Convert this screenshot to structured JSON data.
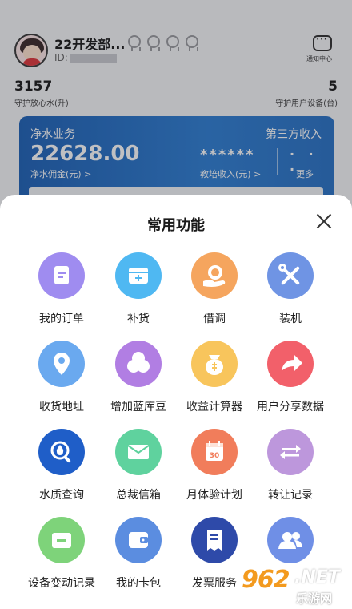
{
  "profile": {
    "name": "22开发部...",
    "id_label": "ID:"
  },
  "message_center": {
    "label": "通知中心"
  },
  "stats": {
    "water": {
      "value": "3157",
      "label": "守护放心水(升)"
    },
    "devices": {
      "value": "5",
      "label": "守护用户设备(台)"
    }
  },
  "business_card": {
    "title": "净水业务",
    "amount": "22628.00",
    "amount_label": "净水佣金(元) >",
    "third_party_title": "第三方收入",
    "masked_amount": "******",
    "masked_label": "教培收入(元) >",
    "more_dots": "· · ·",
    "more_label": "更多"
  },
  "sheet": {
    "title": "常用功能",
    "items": [
      {
        "label": "我的订单",
        "icon": "order-icon",
        "color": "#9f8cf0"
      },
      {
        "label": "补货",
        "icon": "restock-icon",
        "color": "#4fb8f2"
      },
      {
        "label": "借调",
        "icon": "loan-icon",
        "color": "#f5a55e"
      },
      {
        "label": "装机",
        "icon": "tools-icon",
        "color": "#6f94e4"
      },
      {
        "label": "收货地址",
        "icon": "location-icon",
        "color": "#6aa9ef"
      },
      {
        "label": "增加蓝库豆",
        "icon": "beans-icon",
        "color": "#b17ee3"
      },
      {
        "label": "收益计算器",
        "icon": "calculator-bag-icon",
        "color": "#f8c55c"
      },
      {
        "label": "用户分享数据",
        "icon": "share-icon",
        "color": "#f2606a"
      },
      {
        "label": "水质查询",
        "icon": "water-search-icon",
        "color": "#1f5ec8"
      },
      {
        "label": "总裁信箱",
        "icon": "mail-icon",
        "color": "#5fd29e"
      },
      {
        "label": "月体验计划",
        "icon": "calendar-icon",
        "color": "#f17d5b"
      },
      {
        "label": "转让记录",
        "icon": "transfer-icon",
        "color": "#bd97dc"
      },
      {
        "label": "设备变动记录",
        "icon": "device-change-icon",
        "color": "#7ed37a"
      },
      {
        "label": "我的卡包",
        "icon": "wallet-icon",
        "color": "#5b8de0"
      },
      {
        "label": "发票服务",
        "icon": "invoice-icon",
        "color": "#2e4aa9"
      },
      {
        "label": "",
        "icon": "users-icon",
        "color": "#6f8fe6"
      }
    ]
  },
  "watermark": {
    "number": "962",
    "dot_text": ".NET",
    "sub_text": "乐游网"
  }
}
